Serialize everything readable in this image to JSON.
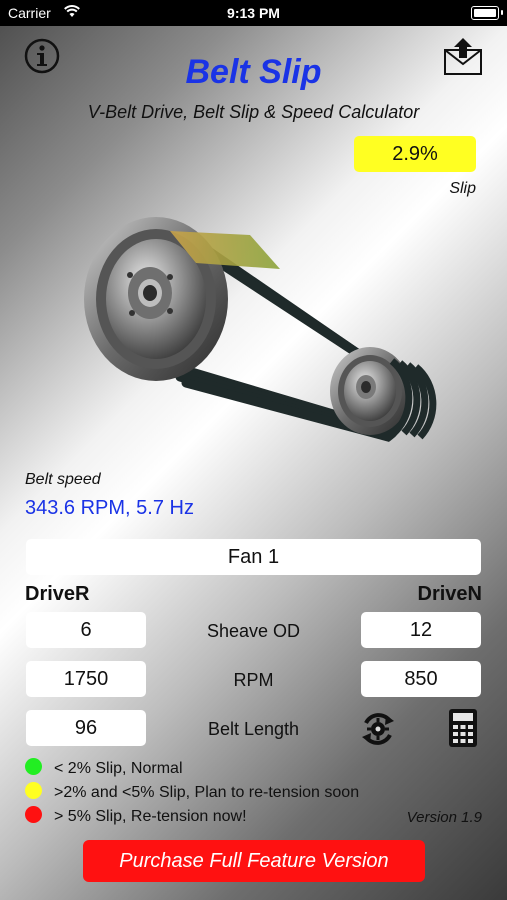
{
  "status_bar": {
    "carrier": "Carrier",
    "time": "9:13 PM",
    "battery_level": 1.0
  },
  "header": {
    "title": "Belt Slip",
    "subtitle": "V-Belt Drive, Belt Slip & Speed Calculator",
    "info_icon": "info-icon",
    "share_icon": "share-icon"
  },
  "slip": {
    "value": "2.9%",
    "label": "Slip",
    "color": "#ffff22"
  },
  "belt_speed": {
    "label": "Belt speed",
    "value": "343.6 RPM, 5.7 Hz"
  },
  "drive_name": "Fan 1",
  "columns": {
    "driver": "DriveR",
    "driven": "DriveN"
  },
  "rows": [
    {
      "label": "Sheave OD",
      "driver": "6",
      "driven": "12"
    },
    {
      "label": "RPM",
      "driver": "1750",
      "driven": "850"
    },
    {
      "label": "Belt Length",
      "driver": "96"
    }
  ],
  "tools": {
    "reset_icon": "reset-gear-icon",
    "calculator_icon": "calculator-icon"
  },
  "legend": [
    {
      "color": "#22ee22",
      "text": "< 2% Slip, Normal"
    },
    {
      "color": "#ffff22",
      "text": ">2% and <5% Slip, Plan to re-tension soon"
    },
    {
      "color": "#ff1111",
      "text": "> 5% Slip, Re-tension now!"
    }
  ],
  "version": "Version 1.9",
  "purchase_button": "Purchase Full Feature Version"
}
